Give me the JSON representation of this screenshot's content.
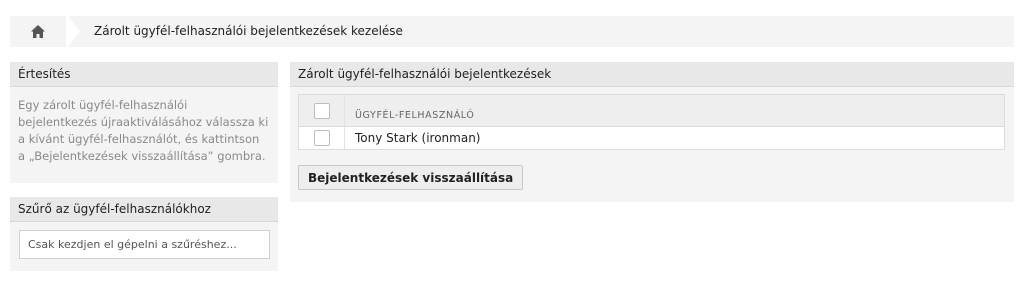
{
  "breadcrumb": {
    "home_icon": "home-icon",
    "current": "Zárolt ügyfél-felhasználói bejelentkezések kezelése"
  },
  "sidebar": {
    "notice": {
      "title": "Értesítés",
      "text": "Egy zárolt ügyfél-felhasználói bejelentkezés újraaktiválásához válassza ki a kívánt ügyfél-felhasználót, és kattintson a „Bejelentkezések visszaállítása” gombra."
    },
    "filter": {
      "title": "Szűrő az ügyfél-felhasználókhoz",
      "placeholder": "Csak kezdjen el gépelni a szűréshez..."
    }
  },
  "main": {
    "title": "Zárolt ügyfél-felhasználói bejelentkezések",
    "table": {
      "header": "ÜGYFÉL-FELHASZNÁLÓ",
      "rows": [
        "Tony Stark (ironman)"
      ]
    },
    "reset_button": "Bejelentkezések visszaállítása"
  },
  "colors": {
    "panel_bg": "#f4f4f4",
    "header_bg": "#e8e8e8"
  }
}
